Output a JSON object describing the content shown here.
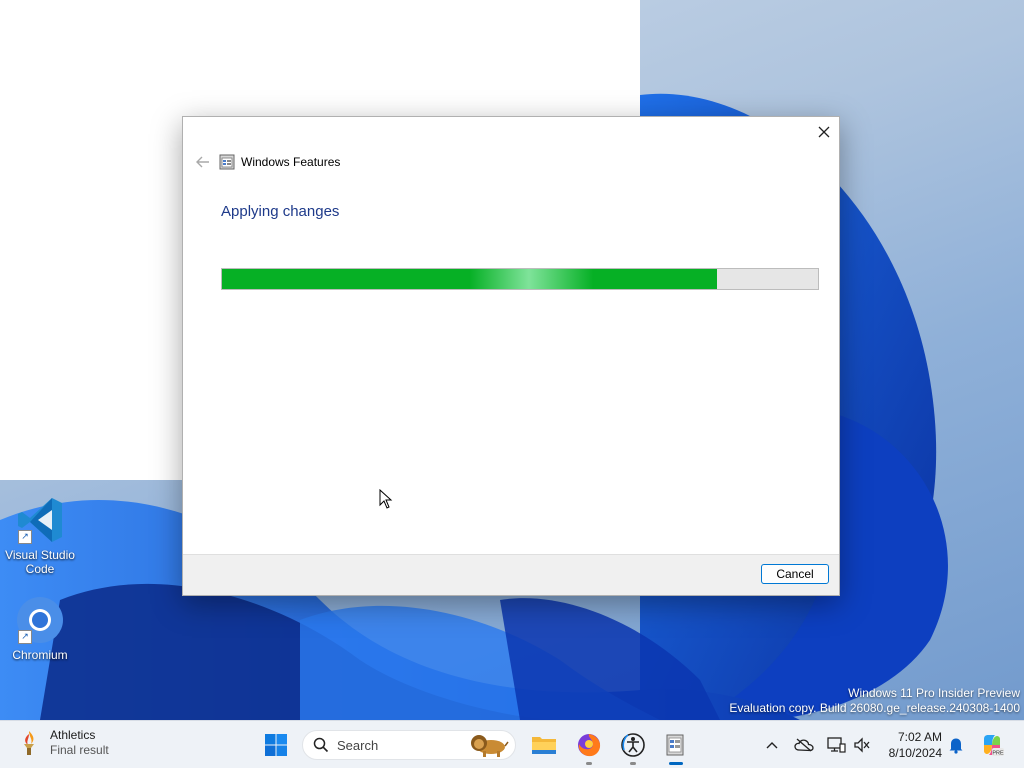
{
  "dialog": {
    "title": "Windows Features",
    "heading": "Applying changes",
    "progress_percent": 83,
    "cancel_label": "Cancel"
  },
  "desktop_icons": [
    {
      "label_line1": "Visual Studio",
      "label_line2": "Code",
      "icon": "vscode-icon"
    },
    {
      "label_line1": "Chromium",
      "label_line2": "",
      "icon": "chromium-icon"
    }
  ],
  "watermark": {
    "line1": "Windows 11 Pro Insider Preview",
    "line2": "Evaluation copy. Build 26080.ge_release.240308-1400"
  },
  "taskbar": {
    "widget_title": "Athletics",
    "widget_subtitle": "Final result",
    "search_placeholder": "Search",
    "time": "7:02 AM",
    "date": "8/10/2024"
  },
  "colors": {
    "progress_green": "#06b025",
    "heading_blue": "#1e3a8a",
    "accent": "#0067c0"
  }
}
